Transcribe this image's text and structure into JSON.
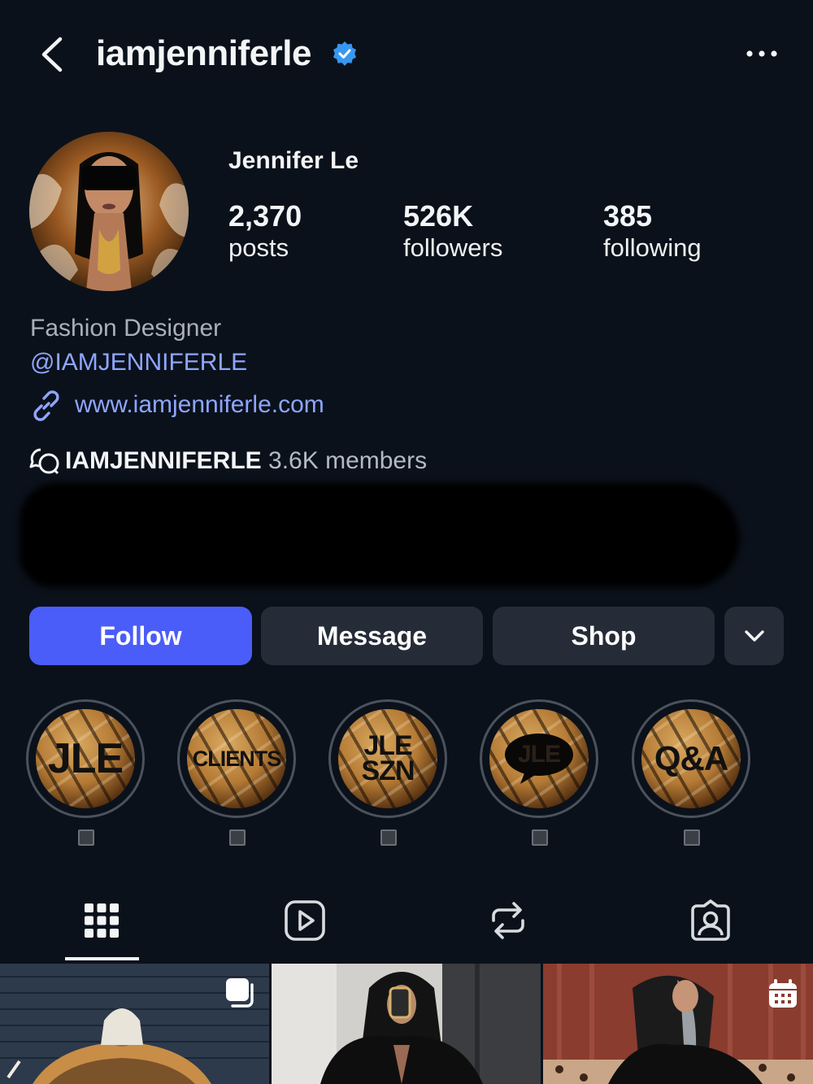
{
  "header": {
    "handle": "iamjenniferle",
    "verified": true
  },
  "profile": {
    "display_name": "Jennifer Le",
    "stats": [
      {
        "value": "2,370",
        "label": "posts"
      },
      {
        "value": "526K",
        "label": "followers"
      },
      {
        "value": "385",
        "label": "following"
      }
    ],
    "category": "Fashion Designer",
    "mention": "@IAMJENNIFERLE",
    "website": "www.iamjenniferle.com",
    "channel_name": "IAMJENNIFERLE",
    "channel_members": "3.6K members"
  },
  "buttons": {
    "follow": "Follow",
    "message": "Message",
    "shop": "Shop"
  },
  "highlights": [
    {
      "cover_text": "JLE"
    },
    {
      "cover_text": "CLIENTS"
    },
    {
      "cover_text": "JLE SZN"
    },
    {
      "cover_text": "JLE"
    },
    {
      "cover_text": "Q&A"
    }
  ],
  "tabs": [
    "grid-icon",
    "reels-icon",
    "reposts-icon",
    "tagged-icon"
  ],
  "colors": {
    "background": "#0b111a",
    "accent": "#4a5df9",
    "link": "#8ea6ff",
    "verified": "#3897f0",
    "secondary_button": "#252c37"
  }
}
